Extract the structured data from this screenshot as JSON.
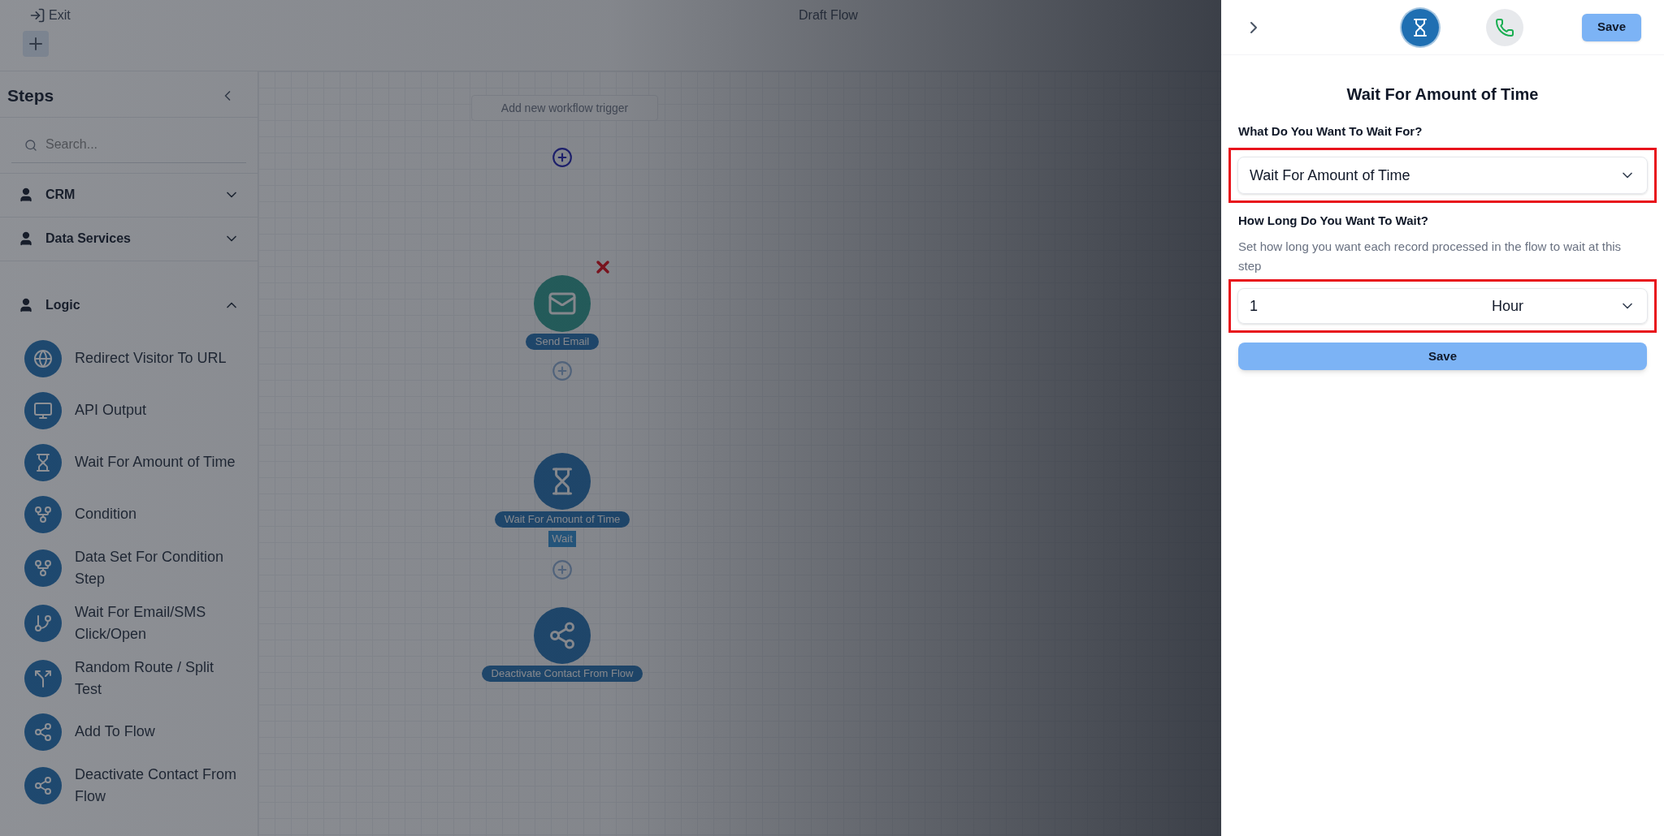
{
  "topbar": {
    "exit_label": "Exit",
    "title": "Draft Flow"
  },
  "sidebar": {
    "title": "Steps",
    "search": {
      "placeholder": "Search..."
    },
    "categories": [
      {
        "label": "CRM",
        "expanded": false
      },
      {
        "label": "Data Services",
        "expanded": false
      },
      {
        "label": "Logic",
        "expanded": true,
        "items": [
          {
            "label": "Redirect Visitor To URL"
          },
          {
            "label": "API Output"
          },
          {
            "label": "Wait For Amount of Time"
          },
          {
            "label": "Condition"
          },
          {
            "label": "Data Set For Condition Step"
          },
          {
            "label": "Wait For Email/SMS Click/Open"
          },
          {
            "label": "Random Route / Split Test"
          },
          {
            "label": "Add To Flow"
          },
          {
            "label": "Deactivate Contact From Flow"
          }
        ]
      }
    ]
  },
  "canvas": {
    "nodes": [
      {
        "kind": "trigger",
        "label": "Add new workflow trigger"
      },
      {
        "kind": "add",
        "active": true
      },
      {
        "kind": "step",
        "label": "Send Email",
        "removable": true
      },
      {
        "kind": "add",
        "active": false
      },
      {
        "kind": "step",
        "label": "Wait For Amount of Time",
        "tag": "Wait"
      },
      {
        "kind": "add",
        "active": false
      },
      {
        "kind": "step",
        "label": "Deactivate Contact From Flow"
      }
    ]
  },
  "panel": {
    "step_tabs": [
      {
        "selected": true
      },
      {
        "selected": false
      }
    ],
    "save_label": "Save",
    "title": "Wait For Amount of Time",
    "sections": [
      {
        "label": "What Do You Want To Wait For?",
        "highlighted": true,
        "value": "Wait For Amount of Time"
      },
      {
        "label": "How Long Do You Want To Wait?",
        "description": "Set how long you want each record processed in the flow to wait at this step",
        "highlighted": true,
        "amount": "1",
        "unit": "Hour"
      }
    ],
    "submit_label": "Save"
  }
}
